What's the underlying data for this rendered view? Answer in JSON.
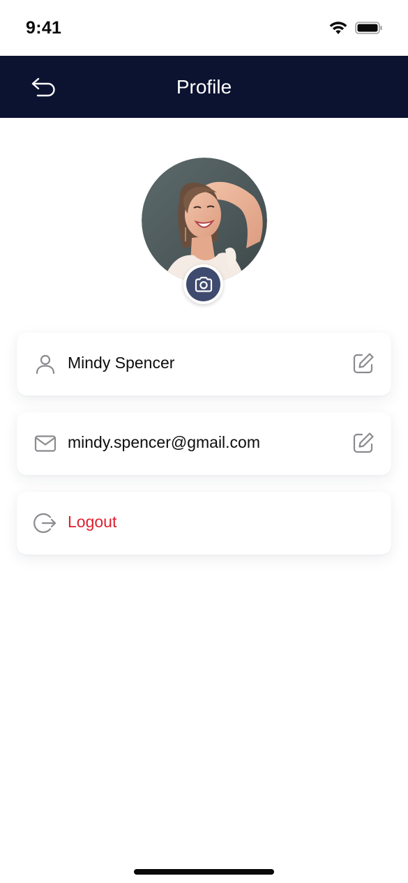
{
  "status_bar": {
    "time": "9:41"
  },
  "header": {
    "title": "Profile",
    "back_icon": "back-arrow-icon"
  },
  "profile": {
    "avatar_alt": "",
    "camera_icon": "camera-icon"
  },
  "fields": {
    "name": {
      "value": "Mindy Spencer",
      "icon": "person-icon",
      "edit_icon": "edit-icon"
    },
    "email": {
      "value": "mindy.spencer@gmail.com",
      "icon": "mail-icon",
      "edit_icon": "edit-icon"
    },
    "logout": {
      "label": "Logout",
      "icon": "logout-icon"
    }
  },
  "colors": {
    "header_bg": "#0c1330",
    "camera_bg": "#3f4b6e",
    "logout_text": "#e0202e",
    "icon_gray": "#8a8a8f"
  }
}
